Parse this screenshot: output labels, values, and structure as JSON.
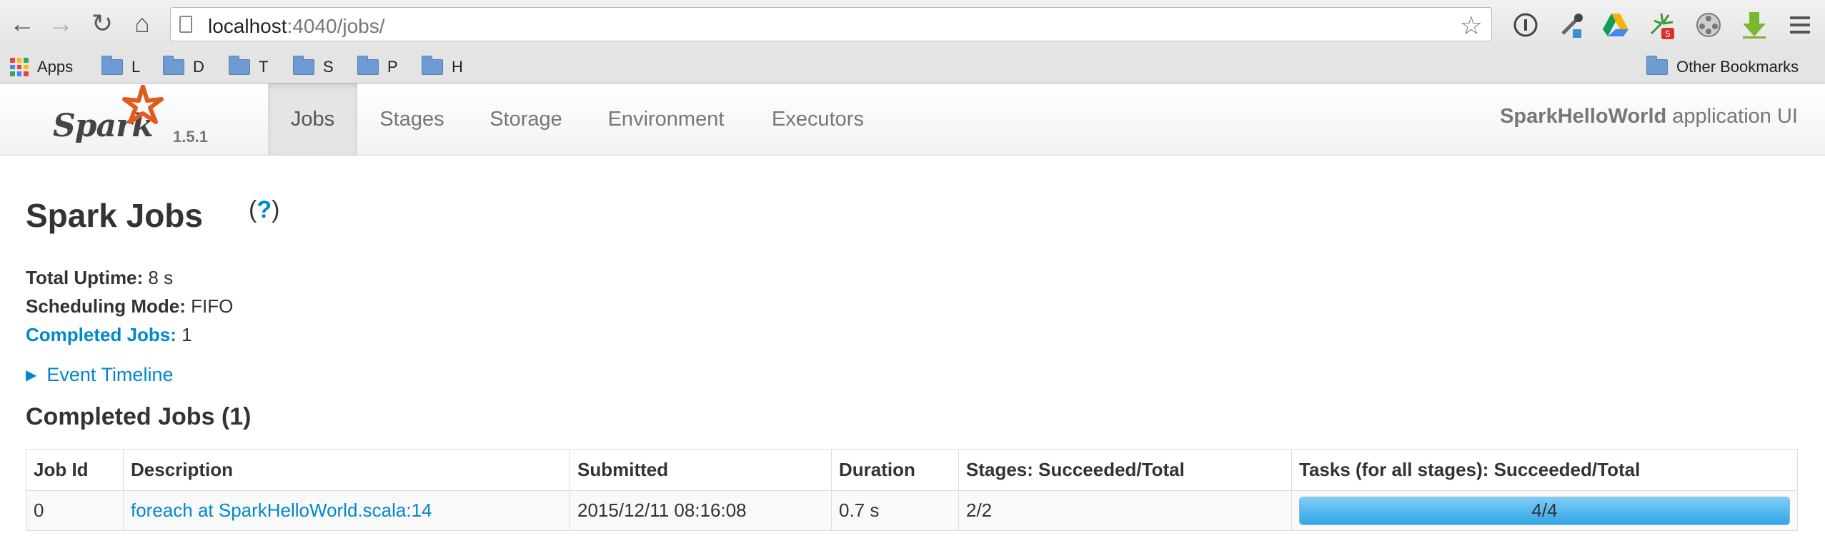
{
  "browser": {
    "url_host": "localhost",
    "url_rest": ":4040/jobs/",
    "bookmarks": [
      {
        "label": "Apps"
      },
      {
        "label": "L"
      },
      {
        "label": "D"
      },
      {
        "label": "T"
      },
      {
        "label": "S"
      },
      {
        "label": "P"
      },
      {
        "label": "H"
      }
    ],
    "other_bookmarks": "Other Bookmarks",
    "extension_badge": "5"
  },
  "header": {
    "logo_text": "Spark",
    "version": "1.5.1",
    "tabs": [
      {
        "label": "Jobs",
        "active": true
      },
      {
        "label": "Stages"
      },
      {
        "label": "Storage"
      },
      {
        "label": "Environment"
      },
      {
        "label": "Executors"
      }
    ],
    "app_name": "SparkHelloWorld",
    "app_suffix": " application UI"
  },
  "page": {
    "title": "Spark Jobs",
    "help_open": "(",
    "help_q": "?",
    "help_close": ")",
    "summary": {
      "uptime_label": "Total Uptime:",
      "uptime_value": " 8 s",
      "mode_label": "Scheduling Mode:",
      "mode_value": " FIFO",
      "completed_label": "Completed Jobs:",
      "completed_value": " 1"
    },
    "event_timeline": "Event Timeline",
    "section_title": "Completed Jobs (1)"
  },
  "jobs_table": {
    "headers": [
      "Job Id",
      "Description",
      "Submitted",
      "Duration",
      "Stages: Succeeded/Total",
      "Tasks (for all stages): Succeeded/Total"
    ],
    "rows": [
      {
        "job_id": "0",
        "description": "foreach at SparkHelloWorld.scala:14",
        "submitted": "2015/12/11 08:16:08",
        "duration": "0.7 s",
        "stages": "2/2",
        "tasks": "4/4",
        "tasks_fraction": 1.0
      }
    ]
  },
  "colors": {
    "link": "#0088cc",
    "progress_fill": "#2fa7e6",
    "spark_orange": "#e25a1c"
  }
}
